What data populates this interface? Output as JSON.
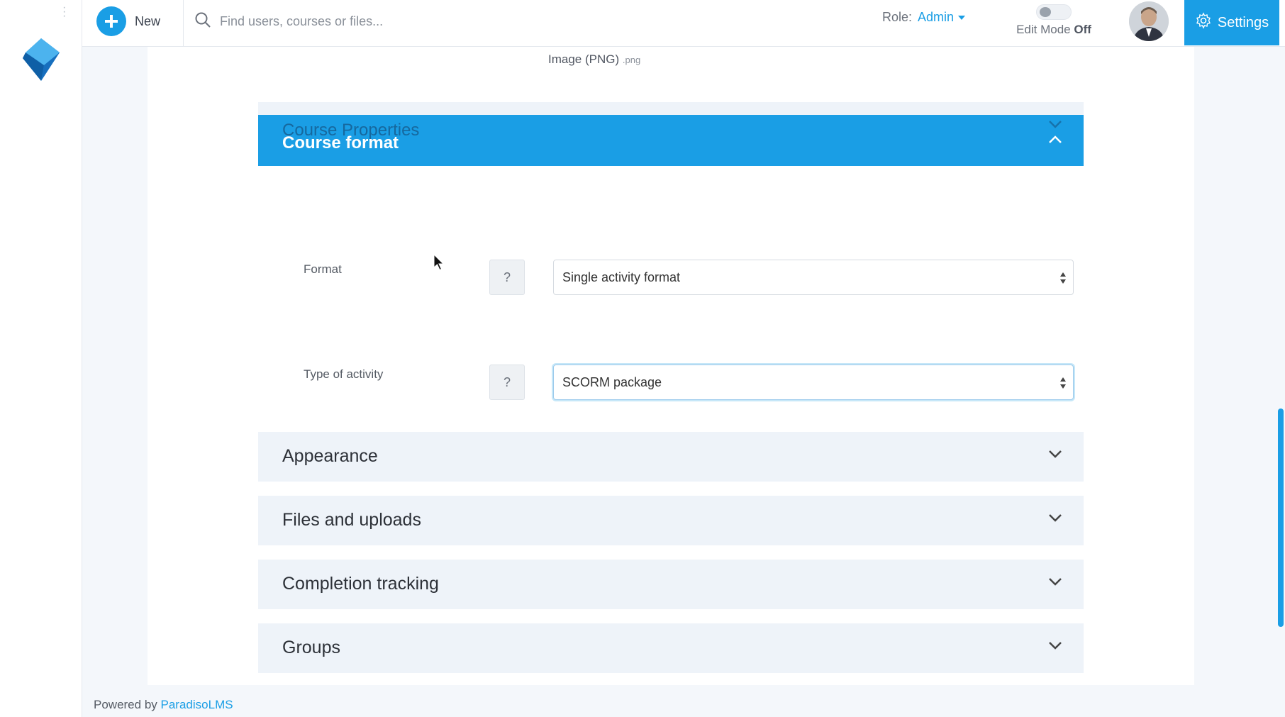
{
  "topbar": {
    "new_label": "New",
    "search_placeholder": "Find users, courses or files...",
    "role_label": "Role:",
    "role_value": "Admin",
    "edit_mode_label": "Edit Mode",
    "edit_mode_state": "Off",
    "settings_label": "Settings"
  },
  "main": {
    "image_type": "Image (PNG)",
    "image_ext": ".png",
    "ghost_section_title": "Course Properties",
    "active_section_title": "Course format",
    "fields": [
      {
        "label": "Format",
        "help": "?",
        "value": "Single activity format"
      },
      {
        "label": "Type of activity",
        "help": "?",
        "value": "SCORM package"
      }
    ],
    "accordions": [
      {
        "title": "Appearance"
      },
      {
        "title": "Files and uploads"
      },
      {
        "title": "Completion tracking"
      },
      {
        "title": "Groups"
      }
    ]
  },
  "footer": {
    "prefix": "Powered by",
    "link": "ParadisoLMS"
  },
  "colors": {
    "accent": "#1a9ee5",
    "section_bg": "#eef3f9",
    "page_bg": "#f4f7fb"
  }
}
